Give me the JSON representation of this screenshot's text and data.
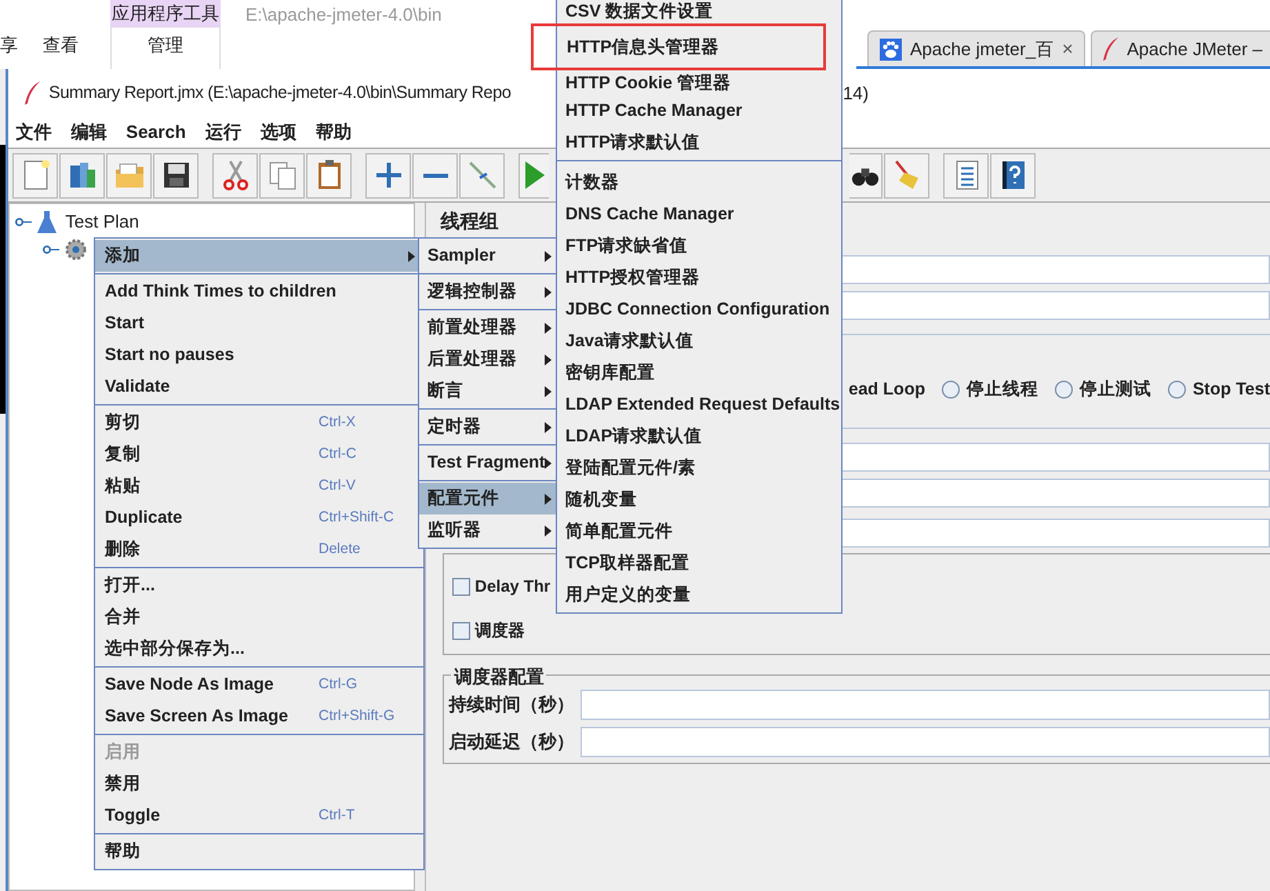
{
  "explorer": {
    "tabs": [
      "享",
      "查看"
    ],
    "contextual_group": "应用程序工具",
    "contextual_tab": "管理",
    "path": "E:\\apache-jmeter-4.0\\bin"
  },
  "browser_tabs": [
    {
      "label": "Apache jmeter_百",
      "close": "×"
    },
    {
      "label": "Apache JMeter –"
    }
  ],
  "window": {
    "title": "Summary Report.jmx (E:\\apache-jmeter-4.0\\bin\\Summary Repo",
    "title_tail": "14)"
  },
  "menu_bar": [
    "文件",
    "编辑",
    "Search",
    "运行",
    "选项",
    "帮助"
  ],
  "toolbar": [
    [
      {
        "kind": "new"
      },
      {
        "kind": "templates"
      },
      {
        "kind": "open"
      },
      {
        "kind": "save"
      }
    ],
    [
      {
        "kind": "cut"
      },
      {
        "kind": "copy"
      },
      {
        "kind": "paste"
      }
    ],
    [
      {
        "kind": "expand"
      },
      {
        "kind": "collapse"
      },
      {
        "kind": "toggle"
      }
    ],
    [
      {
        "kind": "start"
      }
    ],
    [
      {
        "kind": "search"
      },
      {
        "kind": "clear"
      }
    ],
    [
      {
        "kind": "log"
      },
      {
        "kind": "help"
      }
    ]
  ],
  "tree": [
    {
      "label": "Test Plan"
    }
  ],
  "panel": {
    "title": "线程组",
    "loop_fragment": "ead Loop",
    "radios": [
      {
        "label": "停止线程",
        "selected": false
      },
      {
        "label": "停止测试",
        "selected": false
      },
      {
        "label": "Stop Test",
        "selected": false
      }
    ],
    "checkboxes": [
      {
        "label": "Delay Thr",
        "checked": false
      },
      {
        "label": "调度器",
        "checked": false
      }
    ],
    "scheduler": {
      "title": "调度器配置",
      "fields": [
        "持续时间（秒）",
        "启动延迟（秒）"
      ]
    }
  },
  "context_menu": [
    [
      {
        "label": "添加",
        "submenu": true,
        "selected": true
      }
    ],
    [
      {
        "label": "Add Think Times to children"
      },
      {
        "label": "Start"
      },
      {
        "label": "Start no pauses"
      },
      {
        "label": "Validate"
      }
    ],
    [
      {
        "label": "剪切",
        "shortcut": "Ctrl-X"
      },
      {
        "label": "复制",
        "shortcut": "Ctrl-C"
      },
      {
        "label": "粘贴",
        "shortcut": "Ctrl-V"
      },
      {
        "label": "Duplicate",
        "shortcut": "Ctrl+Shift-C"
      },
      {
        "label": "删除",
        "shortcut": "Delete"
      }
    ],
    [
      {
        "label": "打开..."
      },
      {
        "label": "合并"
      },
      {
        "label": "选中部分保存为..."
      }
    ],
    [
      {
        "label": "Save Node As Image",
        "shortcut": "Ctrl-G"
      },
      {
        "label": "Save Screen As Image",
        "shortcut": "Ctrl+Shift-G"
      }
    ],
    [
      {
        "label": "启用",
        "disabled": true
      },
      {
        "label": "禁用",
        "disabled": false
      },
      {
        "label": "Toggle",
        "shortcut": "Ctrl-T",
        "disabled": false
      }
    ],
    [
      {
        "label": "帮助"
      }
    ]
  ],
  "add_submenu": [
    [
      {
        "label": "Sampler",
        "selected": false
      }
    ],
    [
      {
        "label": "逻辑控制器",
        "selected": false
      }
    ],
    [
      {
        "label": "前置处理器",
        "selected": false
      },
      {
        "label": "后置处理器",
        "selected": false
      },
      {
        "label": "断言",
        "selected": false
      }
    ],
    [
      {
        "label": "定时器",
        "selected": false
      }
    ],
    [
      {
        "label": "Test Fragment",
        "selected": false
      }
    ],
    [
      {
        "label": "配置元件",
        "selected": true
      },
      {
        "label": "监听器",
        "selected": false
      }
    ]
  ],
  "config_menu": [
    [
      {
        "label": "CSV 数据文件设置",
        "highlighted": false
      },
      {
        "label": "HTTP信息头管理器",
        "highlighted": true
      },
      {
        "label": "HTTP Cookie 管理器",
        "highlighted": false
      },
      {
        "label": "HTTP Cache Manager",
        "highlighted": false
      },
      {
        "label": "HTTP请求默认值",
        "highlighted": false
      }
    ],
    [
      {
        "label": "计数器",
        "highlighted": false
      },
      {
        "label": "DNS Cache Manager",
        "highlighted": false
      },
      {
        "label": "FTP请求缺省值",
        "highlighted": false
      },
      {
        "label": "HTTP授权管理器",
        "highlighted": false
      },
      {
        "label": "JDBC Connection Configuration",
        "highlighted": false
      },
      {
        "label": "Java请求默认值",
        "highlighted": false
      },
      {
        "label": "密钥库配置",
        "highlighted": false
      },
      {
        "label": "LDAP Extended Request Defaults",
        "highlighted": false
      },
      {
        "label": "LDAP请求默认值",
        "highlighted": false
      },
      {
        "label": "登陆配置元件/素",
        "highlighted": false
      },
      {
        "label": "随机变量",
        "highlighted": false
      },
      {
        "label": "简单配置元件",
        "highlighted": false
      },
      {
        "label": "TCP取样器配置",
        "highlighted": false
      },
      {
        "label": "用户定义的变量",
        "highlighted": false
      }
    ]
  ]
}
